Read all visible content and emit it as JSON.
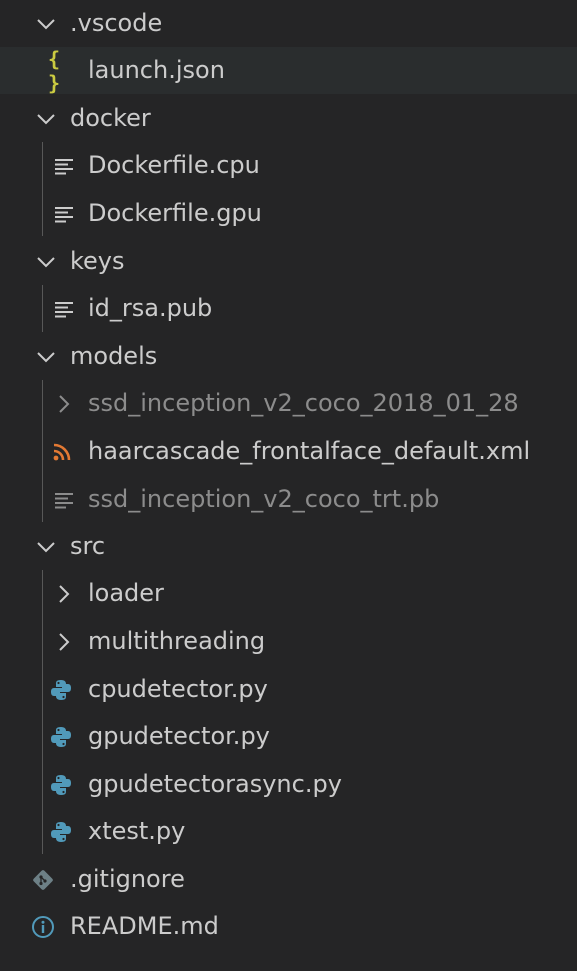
{
  "folders": {
    "vscode": ".vscode",
    "docker": "docker",
    "keys": "keys",
    "models": "models",
    "src": "src"
  },
  "files": {
    "launch_json": "launch.json",
    "dockerfile_cpu": "Dockerfile.cpu",
    "dockerfile_gpu": "Dockerfile.gpu",
    "id_rsa_pub": "id_rsa.pub",
    "ssd_inception_folder": "ssd_inception_v2_coco_2018_01_28",
    "haarcascade": "haarcascade_frontalface_default.xml",
    "ssd_trt_pb": "ssd_inception_v2_coco_trt.pb",
    "loader": "loader",
    "multithreading": "multithreading",
    "cpudetector": "cpudetector.py",
    "gpudetector": "gpudetector.py",
    "gpudetectorasync": "gpudetectorasync.py",
    "xtest": "xtest.py",
    "gitignore": ".gitignore",
    "readme": "README.md"
  },
  "icons": {
    "json": "{ }",
    "colors": {
      "json": "#cbcb41",
      "text_file": "#cccccc",
      "rss": "#e37933",
      "python": "#519aba",
      "git": "#6d8086",
      "info": "#519aba",
      "dim_text": "#8c8c8c"
    }
  }
}
